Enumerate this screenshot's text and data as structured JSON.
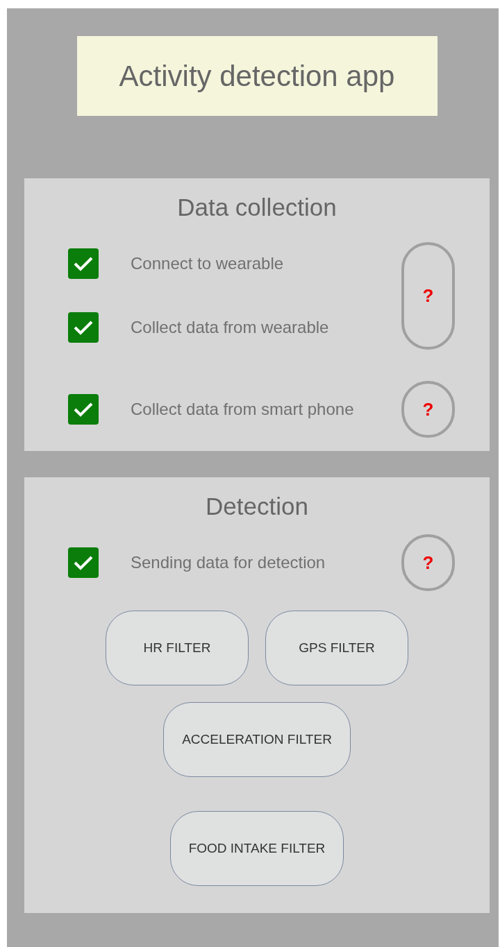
{
  "title": "Activity detection app",
  "sections": [
    {
      "heading": "Data collection",
      "groups": [
        {
          "items": [
            {
              "label": "Connect to wearable",
              "checked": true
            },
            {
              "label": "Collect data from wearable",
              "checked": true
            }
          ],
          "help": "?"
        },
        {
          "items": [
            {
              "label": "Collect data from smart phone",
              "checked": true
            }
          ],
          "help": "?"
        }
      ]
    },
    {
      "heading": "Detection",
      "groups": [
        {
          "items": [
            {
              "label": "Sending data for detection",
              "checked": true
            }
          ],
          "help": "?"
        }
      ],
      "filters": [
        [
          "HR FILTER",
          "GPS FILTER"
        ],
        [
          "ACCELERATION FILTER"
        ],
        [
          "FOOD INTAKE FILTER"
        ]
      ]
    }
  ]
}
